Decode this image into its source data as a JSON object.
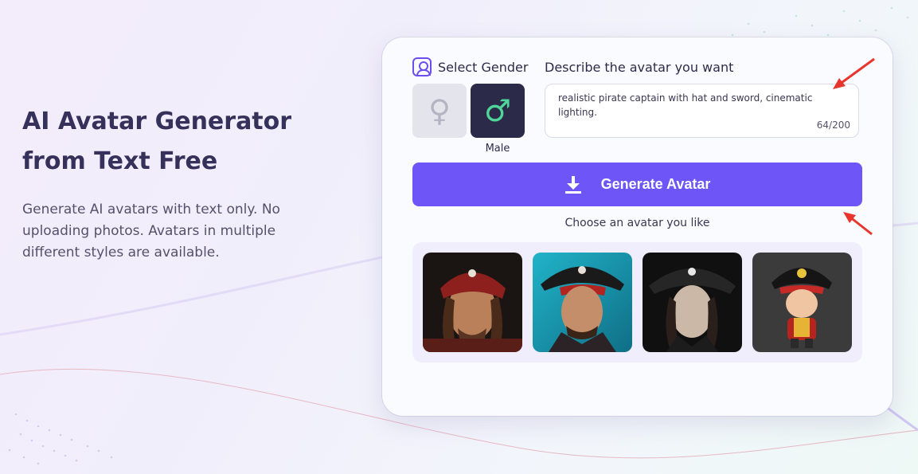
{
  "hero": {
    "title": "AI Avatar Generator from Text Free",
    "description": "Generate AI avatars with text only. No uploading photos. Avatars in multiple different styles are available."
  },
  "form": {
    "gender_label": "Select Gender",
    "gender_options": [
      {
        "symbol": "♀",
        "name": "female-icon"
      },
      {
        "symbol": "♂",
        "name": "male-icon"
      }
    ],
    "selected_gender": "Male",
    "describe_label": "Describe the avatar you want",
    "prompt_value": "realistic pirate captain with hat and sword, cinematic lighting.",
    "char_count": "64/200",
    "generate_label": "Generate Avatar",
    "choose_label": "Choose an avatar you like"
  },
  "colors": {
    "accent": "#6d55f8",
    "male_bg": "#2b2a48",
    "male_symbol": "#4fd69a",
    "arrow": "#e8362f"
  },
  "icons": [
    "user-icon",
    "download-icon"
  ],
  "avatars": [
    {
      "style": "realistic pirate, red bandana"
    },
    {
      "style": "realistic pirate, tricorn hat, teal background"
    },
    {
      "style": "realistic pirate, long hair, dark background"
    },
    {
      "style": "cartoon 3D pirate, red coat"
    }
  ]
}
